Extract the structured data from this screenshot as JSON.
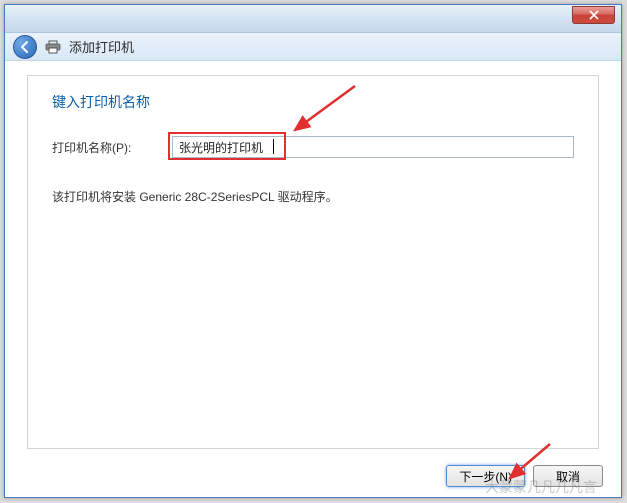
{
  "titlebar": {
    "text": ""
  },
  "nav": {
    "title": "添加打印机"
  },
  "content": {
    "heading": "键入打印机名称",
    "field_label": "打印机名称(P):",
    "field_value": "张光明的打印机",
    "info_text": "该打印机将安装 Generic 28C-2SeriesPCL 驱动程序。"
  },
  "footer": {
    "next_label": "下一步(N)",
    "cancel_label": "取消"
  },
  "watermark": "大蒙蒙几凡几凡言"
}
